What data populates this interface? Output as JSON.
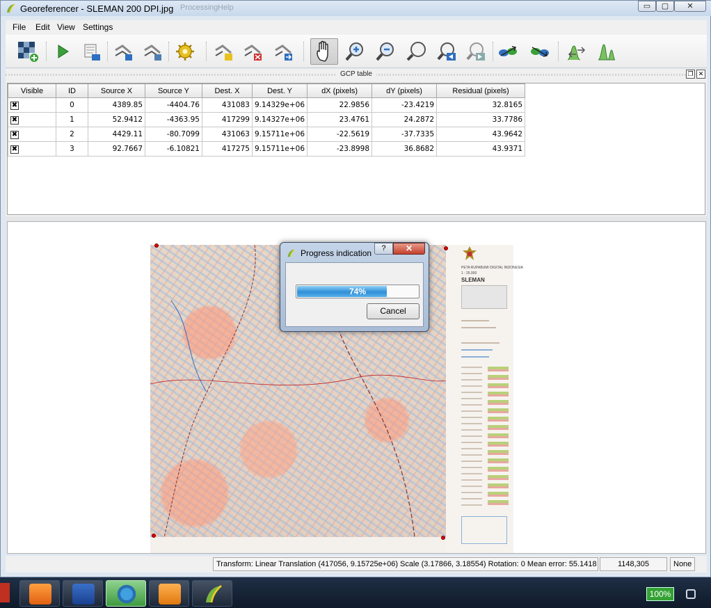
{
  "window": {
    "title": "Georeferencer - SLEMAN 200 DPI.jpg",
    "ghost_menu": [
      "Processing",
      "Help"
    ],
    "controls": {
      "minimize": "▭",
      "maximize": "▢",
      "close": "✕"
    }
  },
  "menubar": {
    "items": [
      "File",
      "Edit",
      "View",
      "Settings"
    ]
  },
  "toolbar": {
    "icons": [
      "open-raster-icon",
      "start-georeferencing-icon",
      "generate-script-icon",
      "load-gcp-icon",
      "save-gcp-icon",
      "transformation-settings-icon",
      "add-point-icon",
      "delete-point-icon",
      "move-point-icon",
      "pan-icon",
      "zoom-in-icon",
      "zoom-out-icon",
      "zoom-to-layer-icon",
      "zoom-last-icon",
      "zoom-next-icon",
      "link-georef-to-qgis-icon",
      "link-qgis-to-georef-icon",
      "full-histogram-stretch-icon",
      "local-histogram-stretch-icon"
    ],
    "colors": {
      "accent_blue": "#2f6fc0",
      "accent_green": "#3aa03a",
      "accent_yellow": "#e8c020"
    }
  },
  "gcp_dock": {
    "title": "GCP table",
    "float_btn": "❐",
    "close_btn": "✕",
    "columns": [
      "Visible",
      "ID",
      "Source X",
      "Source Y",
      "Dest. X",
      "Dest. Y",
      "dX (pixels)",
      "dY (pixels)",
      "Residual (pixels)"
    ],
    "rows": [
      {
        "visible": "✖",
        "id": "0",
        "source_x": "4389.85",
        "source_y": "-4404.76",
        "dest_x": "431083",
        "dest_y": "9.14329e+06",
        "dx": "22.9856",
        "dy": "-23.4219",
        "residual": "32.8165"
      },
      {
        "visible": "✖",
        "id": "1",
        "source_x": "52.9412",
        "source_y": "-4363.95",
        "dest_x": "417299",
        "dest_y": "9.14327e+06",
        "dx": "23.4761",
        "dy": "24.2872",
        "residual": "33.7786"
      },
      {
        "visible": "✖",
        "id": "2",
        "source_x": "4429.11",
        "source_y": "-80.7099",
        "dest_x": "431063",
        "dest_y": "9.15711e+06",
        "dx": "-22.5619",
        "dy": "-37.7335",
        "residual": "43.9642"
      },
      {
        "visible": "✖",
        "id": "3",
        "source_x": "92.7667",
        "source_y": "-6.10821",
        "dest_x": "417275",
        "dest_y": "9.15711e+06",
        "dx": "-23.8998",
        "dy": "36.8682",
        "residual": "43.9371"
      }
    ]
  },
  "map_sheet": {
    "heading": "PETA RUPABUMI DIGITAL INDONESIA",
    "scale": "1 : 25.000",
    "sheet_name": "SLEMAN"
  },
  "statusbar": {
    "transform": "Transform: Linear Translation (417056, 9.15725e+06) Scale (3.17866, 3.18554) Rotation: 0 Mean error: 55.1418",
    "coords": "1148,305",
    "crs": "None"
  },
  "dialog": {
    "title": "Progress indication",
    "help": "?",
    "close": "✕",
    "progress": 0.74,
    "progress_label": "74%",
    "cancel": "Cancel"
  },
  "taskbar": {
    "tasks": [
      "uc-browser-icon",
      "word-icon",
      "internet-download-manager-icon",
      "pdf-reader-icon",
      "qgis-icon"
    ],
    "battery": "100%"
  }
}
